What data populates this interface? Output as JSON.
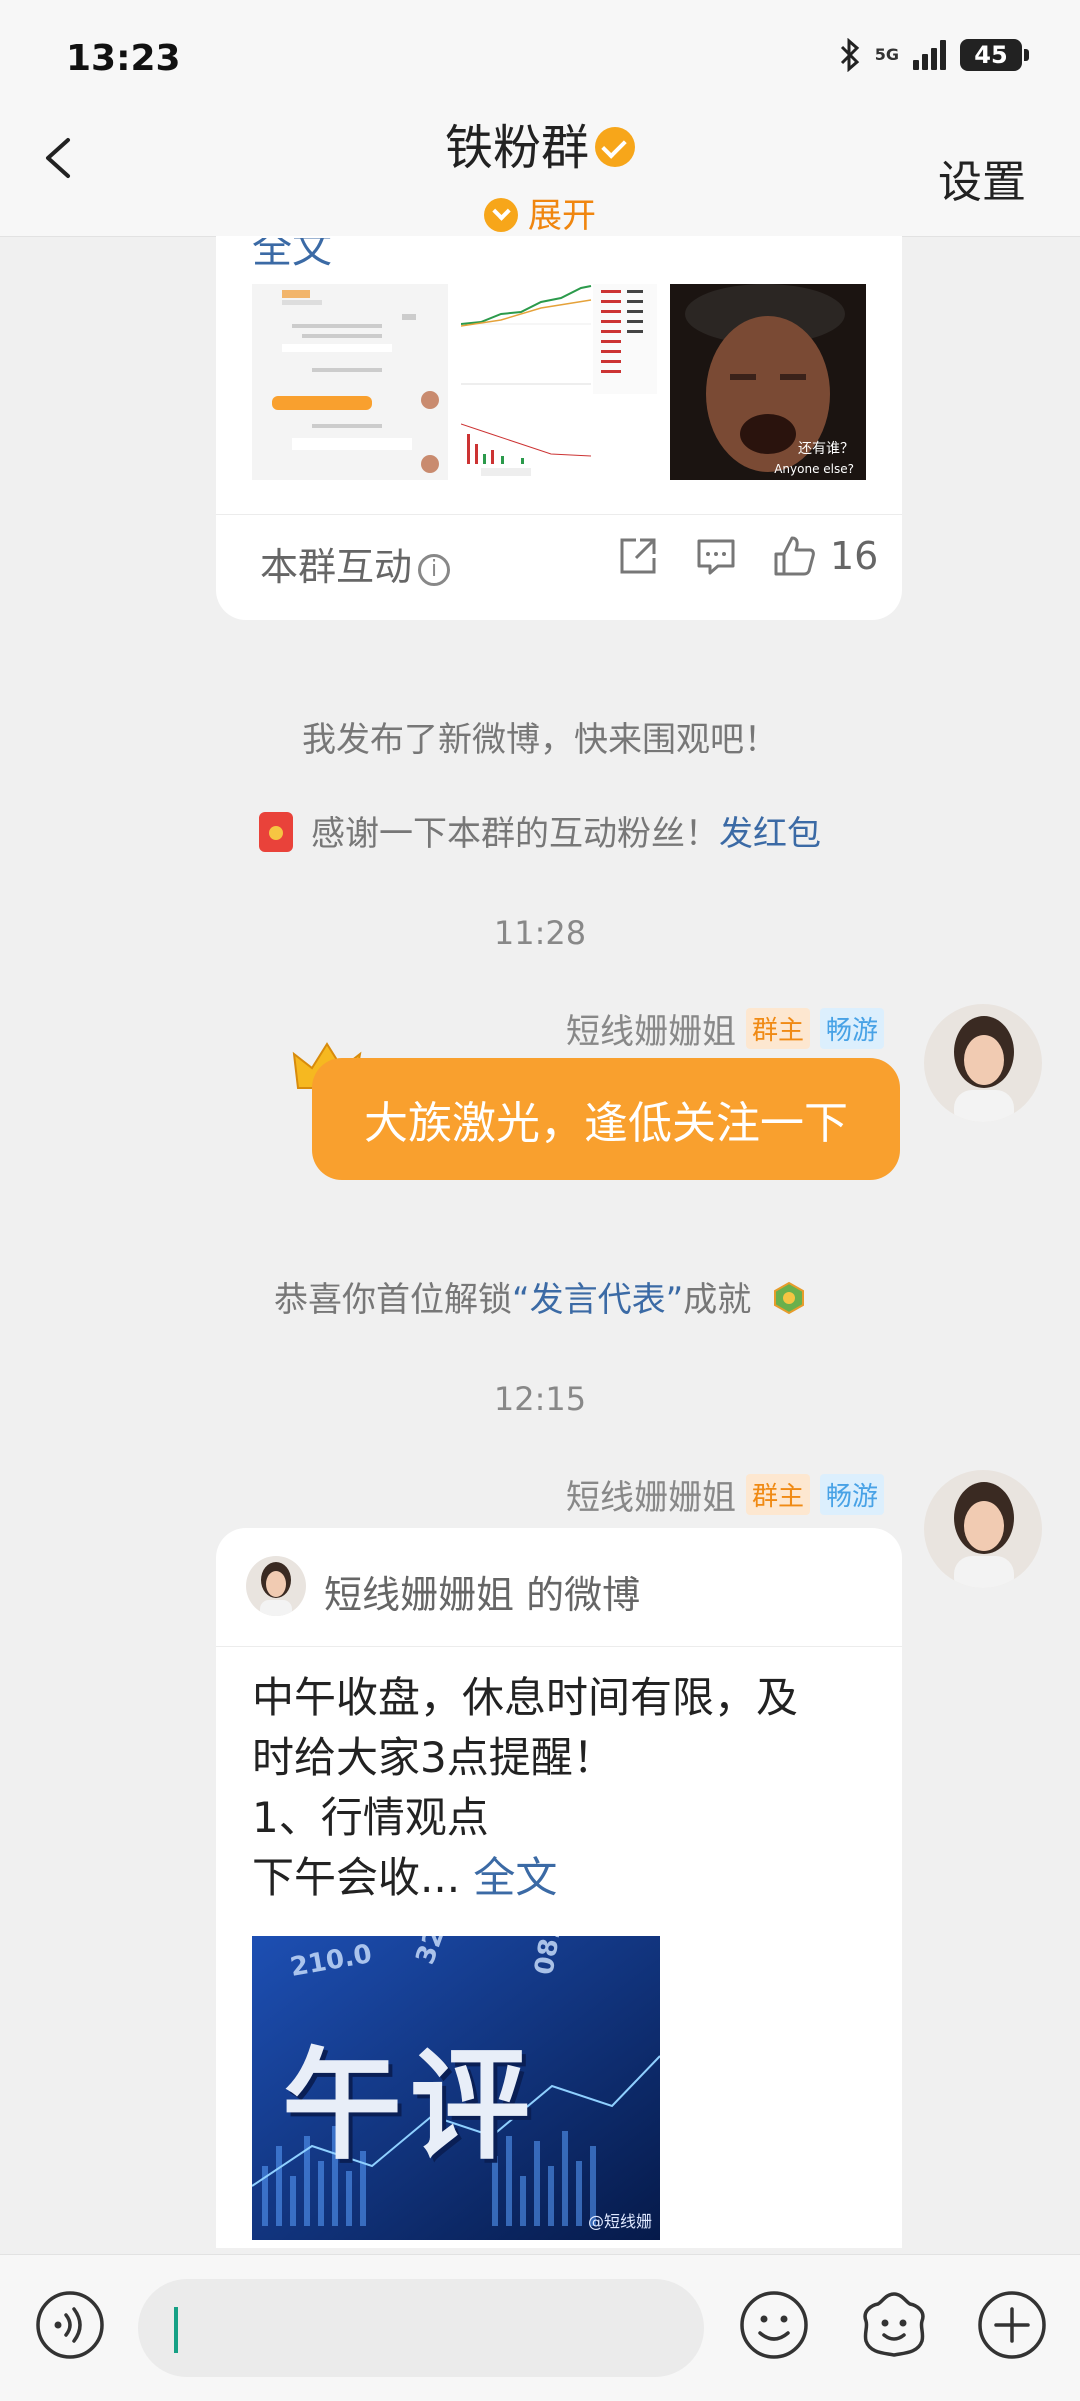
{
  "status_bar": {
    "time": "13:23",
    "network": "5G",
    "battery": "45"
  },
  "header": {
    "title": "铁粉群",
    "expand_label": "展开",
    "settings_label": "设置"
  },
  "card1": {
    "cut_text": "全文",
    "interaction_label": "本群互动",
    "info_glyph": "i",
    "like_count": "16",
    "thumb3_caption_cn": "还有谁？",
    "thumb3_caption_en": "Anyone else?"
  },
  "system": {
    "weibo_notice": "我发布了新微博，快来围观吧！",
    "thanks_text": "感谢一下本群的互动粉丝！",
    "red_packet_link": "发红包",
    "achievement_prefix": "恭喜你首位解锁",
    "achievement_name": "“发言代表”",
    "achievement_suffix": "成就"
  },
  "timestamps": [
    "11:28",
    "12:15"
  ],
  "message1": {
    "sender": "短线姗姗姐",
    "tag_owner": "群主",
    "tag_roam": "畅游",
    "text": "大族激光，逢低关注一下"
  },
  "message2": {
    "sender": "短线姗姗姐",
    "tag_owner": "群主",
    "tag_roam": "畅游",
    "card_title": "短线姗姗姐 的微博",
    "body_lines": [
      "中午收盘，休息时间有限，及",
      "时给大家3点提醒！",
      "1、行情观点"
    ],
    "body_last": "下午会收...",
    "fulltext_link": "全文",
    "image_text": "午评",
    "image_watermark": "@短线姗"
  },
  "colors": {
    "accent_orange": "#f9a02e",
    "link_blue": "#3b6aa5",
    "owner_tag": "#f08a14",
    "roam_tag": "#48a2e6"
  },
  "icons": [
    "back-icon",
    "verified-icon",
    "expand-chevron-icon",
    "share-icon",
    "comment-icon",
    "like-icon",
    "red-packet-icon",
    "crown-icon",
    "medal-icon",
    "voice-icon",
    "emoji-icon",
    "sticker-icon",
    "add-icon"
  ]
}
